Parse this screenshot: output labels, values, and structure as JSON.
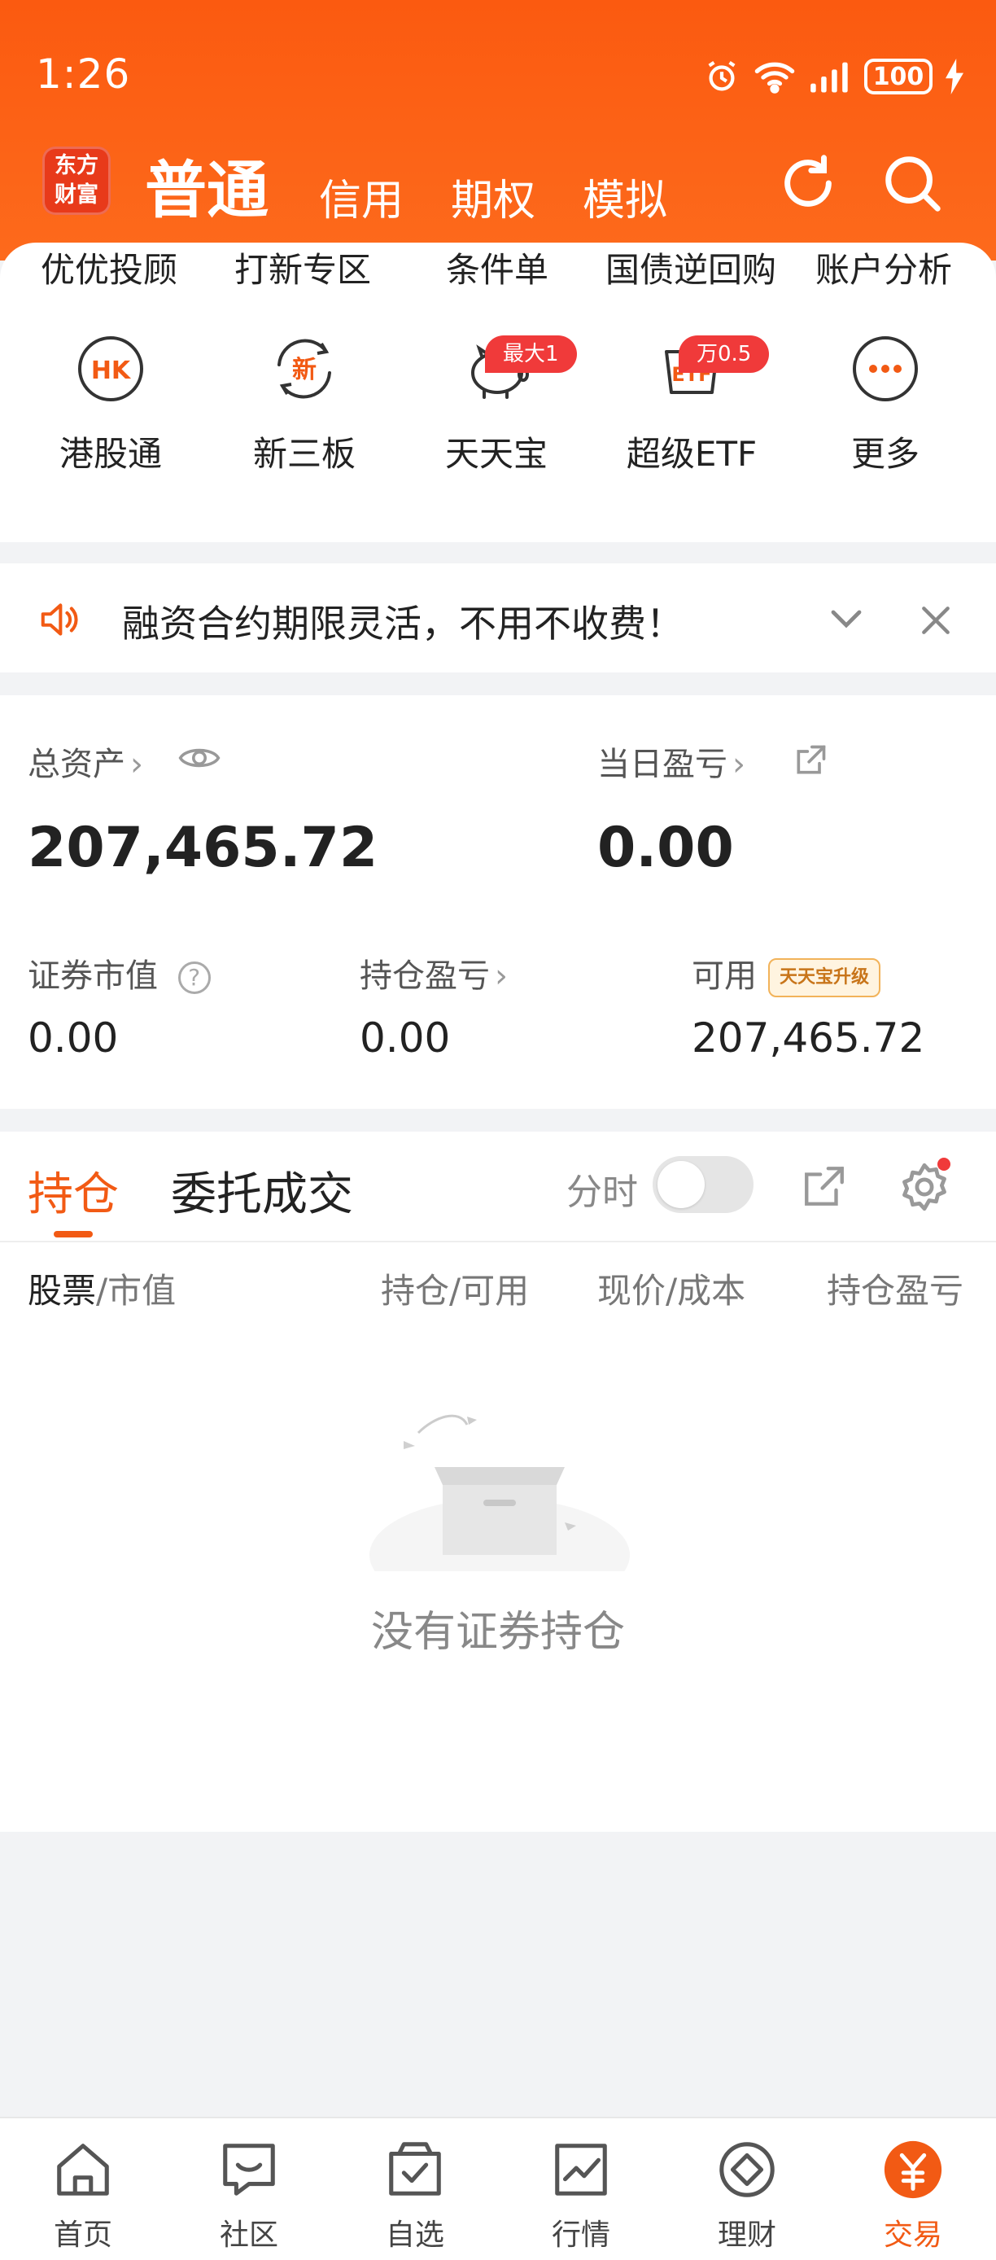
{
  "status_bar": {
    "time": "1:26",
    "battery": "100"
  },
  "header": {
    "logo_line1": "东方",
    "logo_line2": "财富",
    "tabs": [
      "普通",
      "信用",
      "期权",
      "模拟"
    ]
  },
  "quick_links": [
    "优优投顾",
    "打新专区",
    "条件单",
    "国债逆回购",
    "账户分析"
  ],
  "tools": [
    {
      "label": "港股通",
      "icon": "hk-icon",
      "glyph": "HK"
    },
    {
      "label": "新三板",
      "icon": "new-board-icon",
      "glyph": "新"
    },
    {
      "label": "天天宝",
      "icon": "piggy-bank-icon",
      "badge": "最大1"
    },
    {
      "label": "超级ETF",
      "icon": "etf-icon",
      "badge": "万0.5"
    },
    {
      "label": "更多",
      "icon": "more-icon"
    }
  ],
  "notice": {
    "text": "融资合约期限灵活，不用不收费！"
  },
  "assets": {
    "total_label": "总资产",
    "total_value": "207,465.72",
    "daily_pl_label": "当日盈亏",
    "daily_pl_value": "0.00",
    "market_value_label": "证券市值",
    "market_value": "0.00",
    "position_pl_label": "持仓盈亏",
    "position_pl_value": "0.00",
    "available_label": "可用",
    "available_badge": "天天宝升级",
    "available_value": "207,465.72"
  },
  "holdings": {
    "tabs": [
      "持仓",
      "委托成交"
    ],
    "toggle_label": "分时",
    "columns": {
      "stock": "股票",
      "market_value": "/市值",
      "qty": "持仓/可用",
      "price": "现价/成本",
      "pl": "持仓盈亏"
    },
    "empty_text": "没有证券持仓"
  },
  "bottom_nav": [
    "首页",
    "社区",
    "自选",
    "行情",
    "理财",
    "交易"
  ],
  "colors": {
    "accent": "#f25a14",
    "header": "#fb5a10",
    "badge_red": "#f03a3a"
  }
}
